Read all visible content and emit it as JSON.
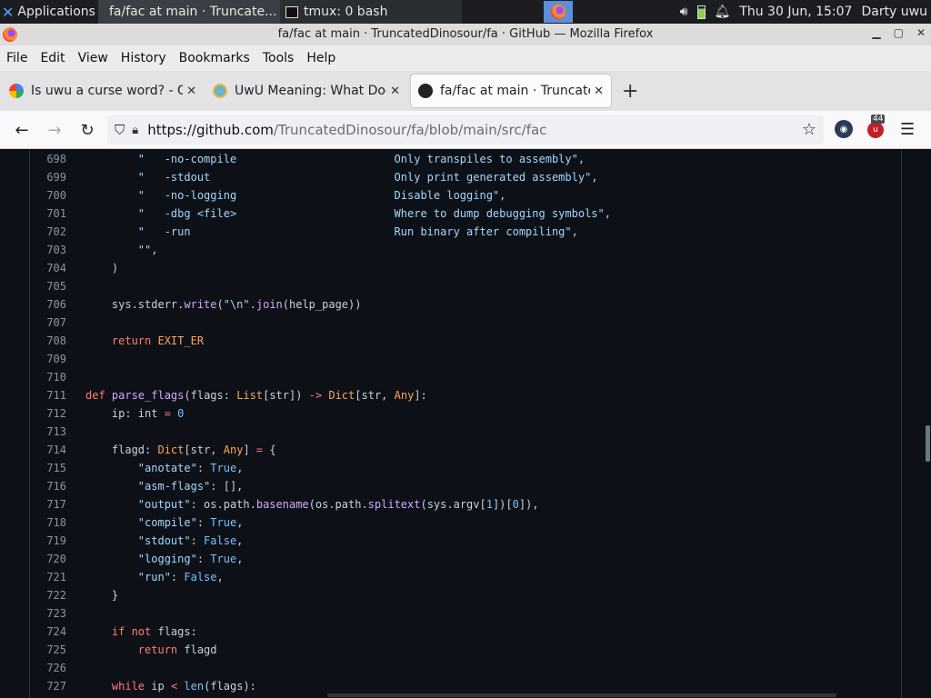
{
  "panel": {
    "applications_label": "Applications",
    "task1_title": "fa/fac at main · Truncate...",
    "task2_title": "tmux: 0 bash",
    "datetime": "Thu 30 Jun, 15:07",
    "user": "Darty uwu"
  },
  "window": {
    "title": "fa/fac at main · TruncatedDinosour/fa · GitHub — Mozilla Firefox"
  },
  "menu": [
    "File",
    "Edit",
    "View",
    "History",
    "Bookmarks",
    "Tools",
    "Help"
  ],
  "tabs": [
    {
      "title": "Is uwu a curse word? - Go"
    },
    {
      "title": "UwU Meaning: What Does"
    },
    {
      "title": "fa/fac at main · Truncated"
    }
  ],
  "nav": {
    "url_host": "https://github.com",
    "url_path": "/TruncatedDinosour/fa/blob/main/src/fac",
    "ext_badge": "44"
  },
  "code": {
    "lines": [
      {
        "n": "698",
        "segs": [
          [
            "s",
            "        \"   -no-compile                        Only transpiles to assembly\","
          ]
        ]
      },
      {
        "n": "699",
        "segs": [
          [
            "s",
            "        \"   -stdout                            Only print generated assembly\","
          ]
        ]
      },
      {
        "n": "700",
        "segs": [
          [
            "s",
            "        \"   -no-logging                        Disable logging\","
          ]
        ]
      },
      {
        "n": "701",
        "segs": [
          [
            "s",
            "        \"   -dbg <file>                        Where to dump debugging symbols\","
          ]
        ]
      },
      {
        "n": "702",
        "segs": [
          [
            "s",
            "        \"   -run                               Run binary after compiling\","
          ]
        ]
      },
      {
        "n": "703",
        "segs": [
          [
            "s",
            "        \"\""
          ],
          [
            "p",
            ","
          ]
        ]
      },
      {
        "n": "704",
        "segs": [
          [
            "p",
            "    )"
          ]
        ]
      },
      {
        "n": "705",
        "segs": []
      },
      {
        "n": "706",
        "segs": [
          [
            "p",
            "    sys.stderr."
          ],
          [
            "f",
            "write"
          ],
          [
            "p",
            "("
          ],
          [
            "s",
            "\"\\n\""
          ],
          [
            "p",
            "."
          ],
          [
            "f",
            "join"
          ],
          [
            "p",
            "(help_page))"
          ]
        ]
      },
      {
        "n": "707",
        "segs": []
      },
      {
        "n": "708",
        "segs": [
          [
            "k",
            "    return "
          ],
          [
            "o",
            "EXIT_ER"
          ]
        ]
      },
      {
        "n": "709",
        "segs": []
      },
      {
        "n": "710",
        "segs": []
      },
      {
        "n": "711",
        "segs": [
          [
            "k",
            "def "
          ],
          [
            "f",
            "parse_flags"
          ],
          [
            "p",
            "(flags: "
          ],
          [
            "o",
            "List"
          ],
          [
            "p",
            "[str]) "
          ],
          [
            "k",
            "->"
          ],
          [
            "p",
            " "
          ],
          [
            "o",
            "Dict"
          ],
          [
            "p",
            "[str, "
          ],
          [
            "o",
            "Any"
          ],
          [
            "p",
            "]:"
          ]
        ]
      },
      {
        "n": "712",
        "segs": [
          [
            "p",
            "    ip: int "
          ],
          [
            "k",
            "="
          ],
          [
            "p",
            " "
          ],
          [
            "c",
            "0"
          ]
        ]
      },
      {
        "n": "713",
        "segs": []
      },
      {
        "n": "714",
        "segs": [
          [
            "p",
            "    flagd: "
          ],
          [
            "o",
            "Dict"
          ],
          [
            "p",
            "[str, "
          ],
          [
            "o",
            "Any"
          ],
          [
            "p",
            "] "
          ],
          [
            "k",
            "="
          ],
          [
            "p",
            " {"
          ]
        ]
      },
      {
        "n": "715",
        "segs": [
          [
            "s",
            "        \"anotate\""
          ],
          [
            "p",
            ": "
          ],
          [
            "c",
            "True"
          ],
          [
            "p",
            ","
          ]
        ]
      },
      {
        "n": "716",
        "segs": [
          [
            "s",
            "        \"asm-flags\""
          ],
          [
            "p",
            ": [],"
          ]
        ]
      },
      {
        "n": "717",
        "segs": [
          [
            "s",
            "        \"output\""
          ],
          [
            "p",
            ": os.path."
          ],
          [
            "f",
            "basename"
          ],
          [
            "p",
            "(os.path."
          ],
          [
            "f",
            "splitext"
          ],
          [
            "p",
            "(sys.argv["
          ],
          [
            "c",
            "1"
          ],
          [
            "p",
            "])["
          ],
          [
            "c",
            "0"
          ],
          [
            "p",
            "]),"
          ]
        ]
      },
      {
        "n": "718",
        "segs": [
          [
            "s",
            "        \"compile\""
          ],
          [
            "p",
            ": "
          ],
          [
            "c",
            "True"
          ],
          [
            "p",
            ","
          ]
        ]
      },
      {
        "n": "719",
        "segs": [
          [
            "s",
            "        \"stdout\""
          ],
          [
            "p",
            ": "
          ],
          [
            "c",
            "False"
          ],
          [
            "p",
            ","
          ]
        ]
      },
      {
        "n": "720",
        "segs": [
          [
            "s",
            "        \"logging\""
          ],
          [
            "p",
            ": "
          ],
          [
            "c",
            "True"
          ],
          [
            "p",
            ","
          ]
        ]
      },
      {
        "n": "721",
        "segs": [
          [
            "s",
            "        \"run\""
          ],
          [
            "p",
            ": "
          ],
          [
            "c",
            "False"
          ],
          [
            "p",
            ","
          ]
        ]
      },
      {
        "n": "722",
        "segs": [
          [
            "p",
            "    }"
          ]
        ]
      },
      {
        "n": "723",
        "segs": []
      },
      {
        "n": "724",
        "segs": [
          [
            "k",
            "    if not "
          ],
          [
            "p",
            "flags:"
          ]
        ]
      },
      {
        "n": "725",
        "segs": [
          [
            "k",
            "        return "
          ],
          [
            "p",
            "flagd"
          ]
        ]
      },
      {
        "n": "726",
        "segs": []
      },
      {
        "n": "727",
        "segs": [
          [
            "k",
            "    while "
          ],
          [
            "p",
            "ip "
          ],
          [
            "k",
            "<"
          ],
          [
            "p",
            " "
          ],
          [
            "c",
            "len"
          ],
          [
            "p",
            "(flags):"
          ]
        ]
      }
    ]
  }
}
